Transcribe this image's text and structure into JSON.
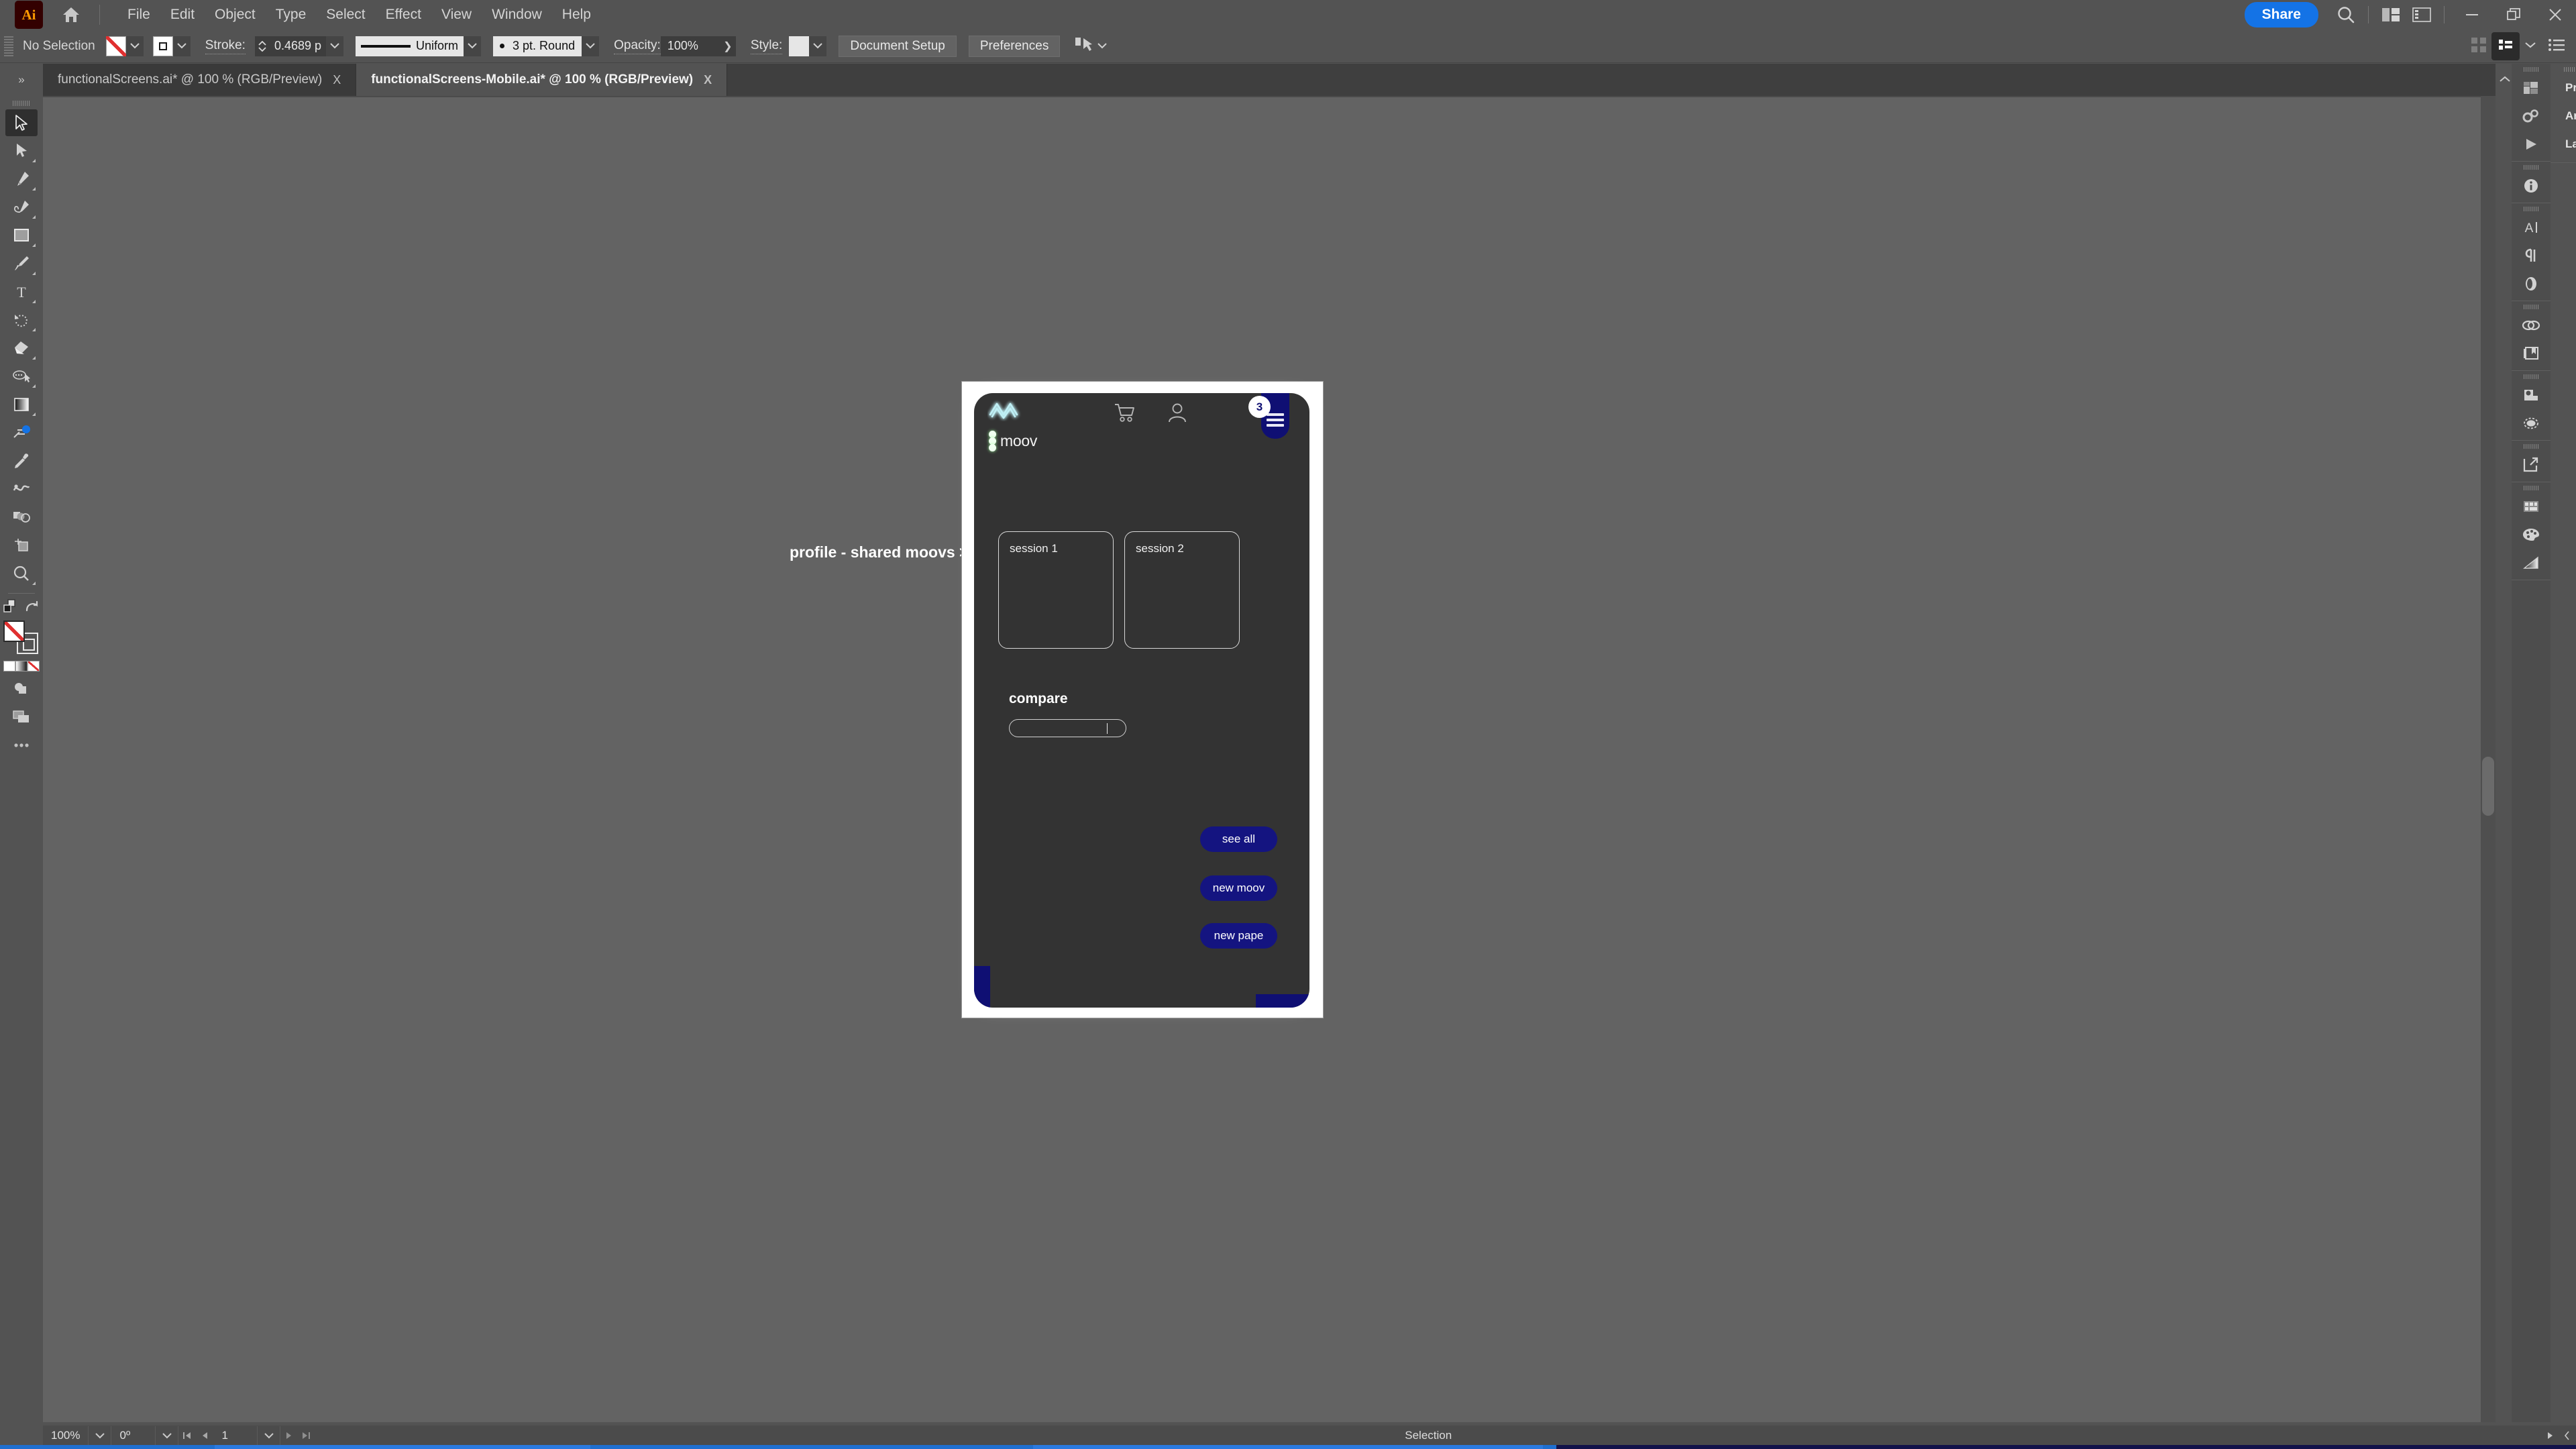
{
  "app": {
    "name": "Adobe Illustrator",
    "logo_text": "Ai"
  },
  "menubar": {
    "items": [
      "File",
      "Edit",
      "Object",
      "Type",
      "Select",
      "Effect",
      "View",
      "Window",
      "Help"
    ],
    "share_label": "Share",
    "icons": [
      "home-icon",
      "search-icon",
      "arrange-documents-icon",
      "workspace-switcher-icon"
    ],
    "window_controls": [
      "minimize",
      "restore",
      "close"
    ]
  },
  "controlbar": {
    "selection_status": "No Selection",
    "fill_swatch": "none",
    "stroke_swatch": "black-square",
    "stroke_label": "Stroke:",
    "stroke_weight": "0.4689 p",
    "stroke_profile": "Uniform",
    "stroke_cap": "3 pt. Round",
    "opacity_label": "Opacity:",
    "opacity_value": "100%",
    "style_label": "Style:",
    "document_setup_label": "Document Setup",
    "preferences_label": "Preferences"
  },
  "tabs": [
    {
      "title": "functionalScreens.ai* @ 100 % (RGB/Preview)",
      "active": false,
      "close": "X"
    },
    {
      "title": "functionalScreens-Mobile.ai* @ 100 % (RGB/Preview)",
      "active": true,
      "close": "X"
    }
  ],
  "toolbar": {
    "tools": [
      "selection-tool",
      "direct-selection-tool",
      "pen-tool",
      "curvature-tool",
      "rectangle-tool",
      "paintbrush-tool",
      "type-tool",
      "rotate-tool",
      "eraser-tool",
      "shape-builder-tool",
      "gradient-tool",
      "width-tool",
      "eyedropper-tool",
      "blend-tool",
      "artboard-tool-group",
      "artboard-tool",
      "zoom-tool",
      "swap-fill-stroke",
      "default-fill-stroke",
      "fill-swatch",
      "stroke-swatch",
      "color-mode-row",
      "drawing-mode",
      "screen-mode",
      "edit-toolbar"
    ]
  },
  "canvas": {
    "annotation_label": "profile - shared moovs >",
    "artboard_background": "#ffffff"
  },
  "mockup": {
    "background": "#333333",
    "accent_blue": "#141480",
    "header": {
      "logo": "moov-neon-logo",
      "cart_icon": "cart-icon",
      "user_icon": "user-icon",
      "menu_icon": "hamburger-menu-icon",
      "badge_count": "3",
      "brand_label": "moov"
    },
    "sessions": [
      {
        "label": "session 1"
      },
      {
        "label": "session 2"
      }
    ],
    "compare": {
      "title": "compare",
      "input_value": ""
    },
    "buttons": [
      {
        "label": "see all"
      },
      {
        "label": "new moov"
      },
      {
        "label": "new pape"
      }
    ]
  },
  "right_dock": {
    "panel_items": [
      {
        "label": "Properties",
        "icon": "sliders-icon"
      },
      {
        "label": "Artboards",
        "icon": "artboards-icon"
      },
      {
        "label": "Layers",
        "icon": "layers-icon"
      }
    ],
    "rail_icons": [
      "libraries-icon",
      "actions-icon",
      "play-icon",
      "info-icon",
      "character-icon",
      "paragraph-icon",
      "opentype-icon",
      "links-icon",
      "asset-export-icon",
      "image-trace-icon",
      "transparency-icon",
      "export-icon",
      "swatches-icon",
      "color-icon",
      "gradient-icon"
    ]
  },
  "statusbar": {
    "zoom_value": "100%",
    "rotation_value": "0º",
    "artboard_number": "1",
    "status_text": "Selection"
  },
  "colors": {
    "chrome": "#535353",
    "canvas": "#636363",
    "accent": "#1473e6",
    "mockup_blue": "#141480",
    "panel_dark": "#3d3d3d"
  }
}
